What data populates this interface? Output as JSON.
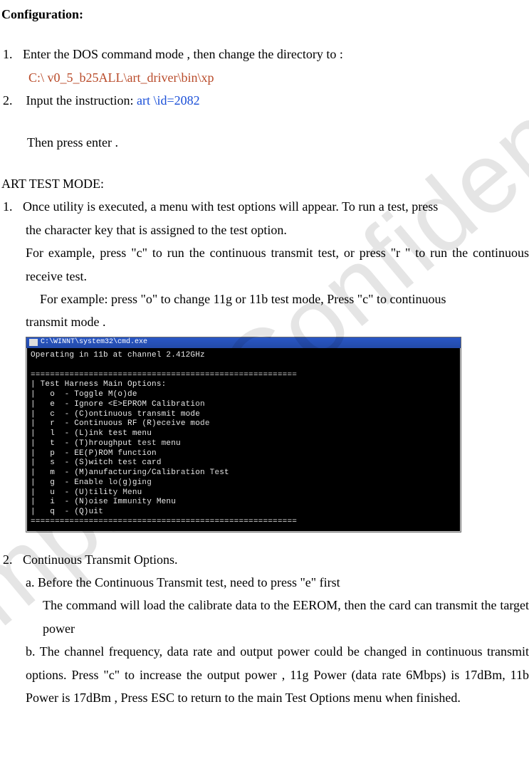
{
  "watermark": "Company Confidential",
  "heading": "Configuration:",
  "step1_num": "1.",
  "step1_text": "Enter the DOS command mode , then change the directory to :",
  "step1_path": "C:\\ v0_5_b25ALL\\art_driver\\bin\\xp",
  "step2_num": "2.",
  "step2_text_a": " Input the instruction: ",
  "step2_cmd": "art \\id=2082",
  "step2_then": "Then press enter .",
  "art_heading": "ART TEST MODE:",
  "art1_num": "1.",
  "art1_p1": "Once utility is executed, a menu with test options will appear. To run a test, press the character key that is assigned to the test option.",
  "art1_p2": "For example, press \"c\" to run the continuous transmit test, or press \"r \" to run the continuous receive test.",
  "art1_p3": "For example: press \"o\" to change 11g or 11b test mode, Press \"c\" to continuous transmit mode .",
  "terminal": {
    "title": "C:\\WINNT\\system32\\cmd.exe",
    "l0": "Operating in 11b at channel 2.412GHz",
    "sep": "=======================================================",
    "hdr": "| Test Harness Main Options:",
    "o1": "|   o  - Toggle M(o)de",
    "o2": "|   e  - Ignore <E>EPROM Calibration",
    "o3": "|   c  - (C)ontinuous transmit mode",
    "o4": "|   r  - Continuous RF (R)eceive mode",
    "o5": "|   l  - (L)ink test menu",
    "o6": "|   t  - (T)hroughput test menu",
    "o7": "|   p  - EE(P)ROM function",
    "o8": "|   s  - (S)witch test card",
    "o9": "|   m  - (M)anufacturing/Calibration Test",
    "o10": "|   g  - Enable lo(g)ging",
    "o11": "|   u  - (U)tility Menu",
    "o12": "|   i  - (N)oise Immunity Menu",
    "o13": "|   q  - (Q)uit"
  },
  "art2_num": "2.",
  "art2_title": "Continuous Transmit Options.",
  "art2_a_label": "a. Before the Continuous Transmit test, need to press \"e\" first",
  "art2_a_body": "The command will load the calibrate data to the EEROM, then the card can transmit the target power",
  "art2_b": "b. The channel frequency, data rate and output power could be changed in continuous transmit options. Press \"c\" to increase the output power , 11g Power (data rate 6Mbps) is 17dBm, 11b   Power is 17dBm , Press ESC to return to the main Test Options menu when finished."
}
